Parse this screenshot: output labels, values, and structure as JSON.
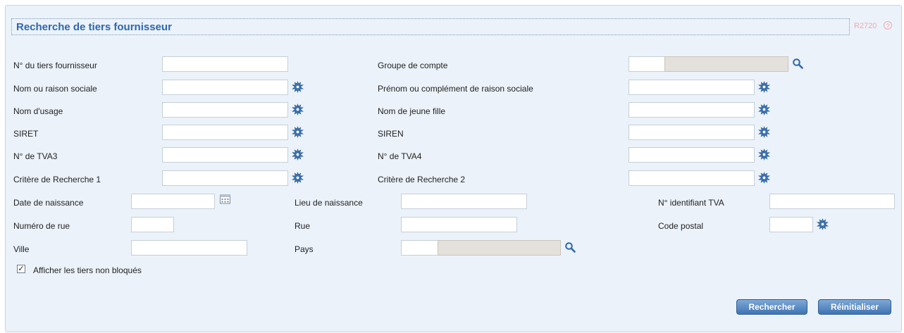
{
  "header": {
    "title": "Recherche de tiers fournisseur",
    "code": "R2720",
    "help_glyph": "?"
  },
  "fields": {
    "num_tiers": {
      "label": "N° du tiers fournisseur",
      "value": ""
    },
    "groupe_compte": {
      "label": "Groupe de compte",
      "value": "",
      "lookup_value": ""
    },
    "nom_raison": {
      "label": "Nom ou raison sociale",
      "value": ""
    },
    "prenom": {
      "label": "Prénom ou complément de raison sociale",
      "value": ""
    },
    "nom_usage": {
      "label": "Nom d'usage",
      "value": ""
    },
    "nom_jeune_fille": {
      "label": "Nom de jeune fille",
      "value": ""
    },
    "siret": {
      "label": "SIRET",
      "value": ""
    },
    "siren": {
      "label": "SIREN",
      "value": ""
    },
    "tva3": {
      "label": "N° de TVA3",
      "value": ""
    },
    "tva4": {
      "label": "N° de TVA4",
      "value": ""
    },
    "critere1": {
      "label": "Critère de Recherche 1",
      "value": ""
    },
    "critere2": {
      "label": "Critère de Recherche 2",
      "value": ""
    },
    "date_naissance": {
      "label": "Date de naissance",
      "value": ""
    },
    "lieu_naissance": {
      "label": "Lieu de naissance",
      "value": ""
    },
    "identifiant_tva": {
      "label": "N° identifiant TVA",
      "value": ""
    },
    "numero_rue": {
      "label": "Numéro de rue",
      "value": ""
    },
    "rue": {
      "label": "Rue",
      "value": ""
    },
    "code_postal": {
      "label": "Code postal",
      "value": ""
    },
    "ville": {
      "label": "Ville",
      "value": ""
    },
    "pays": {
      "label": "Pays",
      "value": "",
      "lookup_value": ""
    }
  },
  "checkbox": {
    "label": "Afficher les tiers non bloqués",
    "checked": true,
    "glyph": "✓"
  },
  "buttons": {
    "search": "Rechercher",
    "reset": "Réinitialiser"
  },
  "icons": {
    "wildcard": "wildcard-search-icon",
    "magnifier": "magnifier-icon",
    "calendar": "calendar-icon",
    "help": "help-icon"
  },
  "colors": {
    "panel_bg": "#ebf2fa",
    "title": "#2e67ac",
    "code": "#f0a8a8",
    "button": "#3f74b3"
  }
}
